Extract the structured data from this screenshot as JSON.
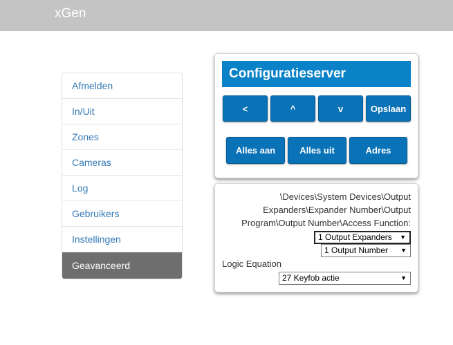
{
  "app": {
    "title": "xGen"
  },
  "sidebar": {
    "items": [
      {
        "label": "Afmelden"
      },
      {
        "label": "In/Uit"
      },
      {
        "label": "Zones"
      },
      {
        "label": "Cameras"
      },
      {
        "label": "Log"
      },
      {
        "label": "Gebruikers"
      },
      {
        "label": "Instellingen"
      },
      {
        "label": "Geavanceerd",
        "active": true
      }
    ]
  },
  "config_panel": {
    "title": "Configuratieserver",
    "buttons": {
      "prev": "<",
      "up": "^",
      "down": "v",
      "save": "Opslaan",
      "all_on": "Alles aan",
      "all_off": "Alles uit",
      "address": "Adres"
    }
  },
  "detail_panel": {
    "path_line1": "\\Devices\\System Devices\\Output",
    "path_line2": "Expanders\\Expander Number\\Output",
    "path_line3": "Program\\Output Number\\Access Function:",
    "expander_select": "1 Output Expanders",
    "number_select": "1 Output Number",
    "logic_label": "Logic Equation",
    "logic_select": "27 Keyfob actie"
  },
  "colors": {
    "topbar": "#c4c4c4",
    "accent": "#0a82c8",
    "button": "#0a72b7",
    "link": "#337ab7",
    "active_nav": "#6e6e6e"
  }
}
